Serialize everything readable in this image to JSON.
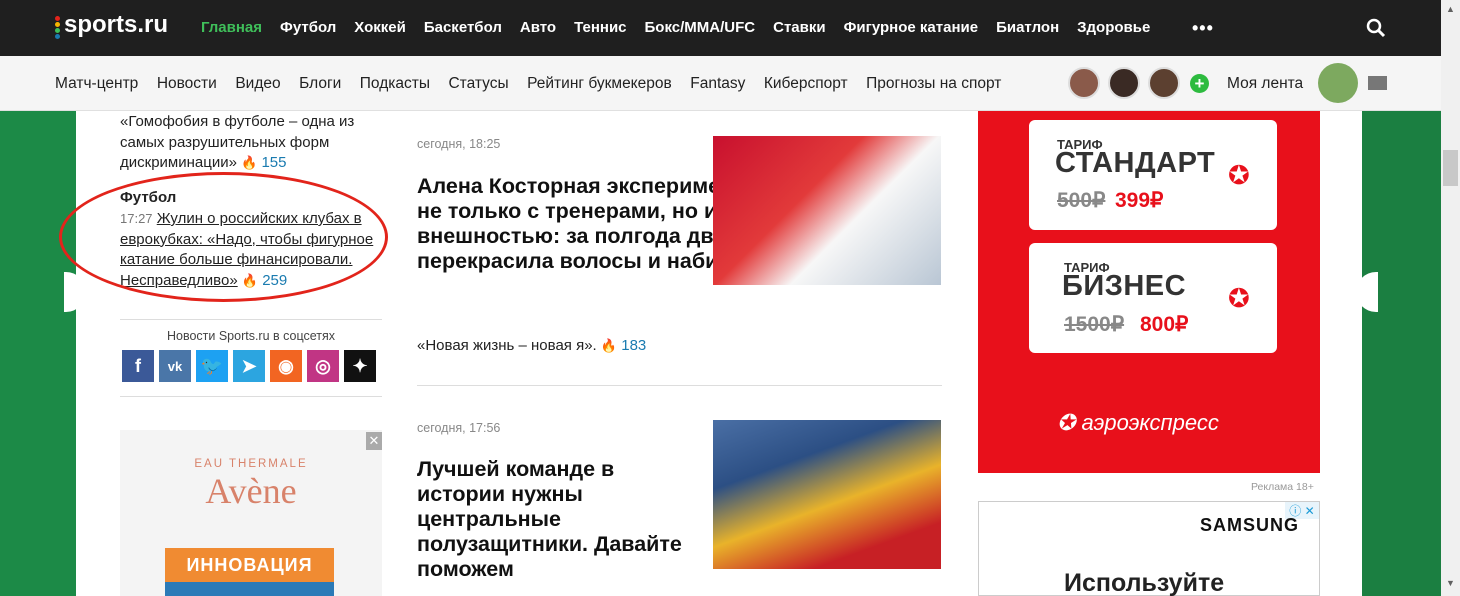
{
  "header": {
    "logo": "sports.ru",
    "nav": [
      "Главная",
      "Футбол",
      "Хоккей",
      "Баскетбол",
      "Авто",
      "Теннис",
      "Бокс/MMA/UFC",
      "Ставки",
      "Фигурное катание",
      "Биатлон",
      "Здоровье"
    ],
    "more": "•••"
  },
  "subnav": {
    "items": [
      "Матч-центр",
      "Новости",
      "Видео",
      "Блоги",
      "Подкасты",
      "Статусы",
      "Рейтинг букмекеров",
      "Fantasy",
      "Киберспорт",
      "Прогнозы на спорт"
    ],
    "plus": "+",
    "my_feed": "Моя лента"
  },
  "left": {
    "quote_text": "«Гомофобия в футболе – одна из самых разрушительных форм дискриминации»",
    "quote_count": "155",
    "section": "Футбол",
    "news_time": "17:27",
    "news_link": "Жулин о российских клубах в еврокубках: «Надо, чтобы фигурное катание больше финансировали. Несправедливо»",
    "news_count": "259",
    "social_title": "Новости Sports.ru в соцсетях",
    "socials": [
      "f",
      "vk",
      "tw",
      "tg",
      "rss",
      "ig",
      "zen"
    ]
  },
  "ad_avene": {
    "eau": "EAU THERMALE",
    "brand": "Avène",
    "badge": "ИННОВАЦИЯ",
    "close": "✕"
  },
  "articles": [
    {
      "meta": "сегодня, 18:25",
      "title": "Алена Косторная экспериментирует не только с тренерами, но и с внешностью: за полгода дважды перекрасила волосы и набила татуху",
      "lead": "«Новая жизнь – новая я».",
      "count": "183"
    },
    {
      "meta": "сегодня, 17:56",
      "title": "Лучшей команде в истории нужны центральные полузащитники. Давайте поможем"
    }
  ],
  "ad_aero": {
    "tariff1_label": "ТАРИФ",
    "tariff1_name": "СТАНДАРТ",
    "tariff1_old": "500₽",
    "tariff1_new": "399₽",
    "tariff2_label": "ТАРИФ",
    "tariff2_name": "БИЗНЕС",
    "tariff2_old": "1500₽",
    "tariff2_new": "800₽",
    "brand": "аэроэкспресс",
    "label": "Реклама 18+"
  },
  "ad_samsung": {
    "brand": "SAMSUNG",
    "text": "Используйте",
    "icons": "ⓘ ✕"
  },
  "colors": {
    "accent_green": "#3fbf5a",
    "brand_red": "#e8101b",
    "link_blue": "#1a7bb0"
  }
}
